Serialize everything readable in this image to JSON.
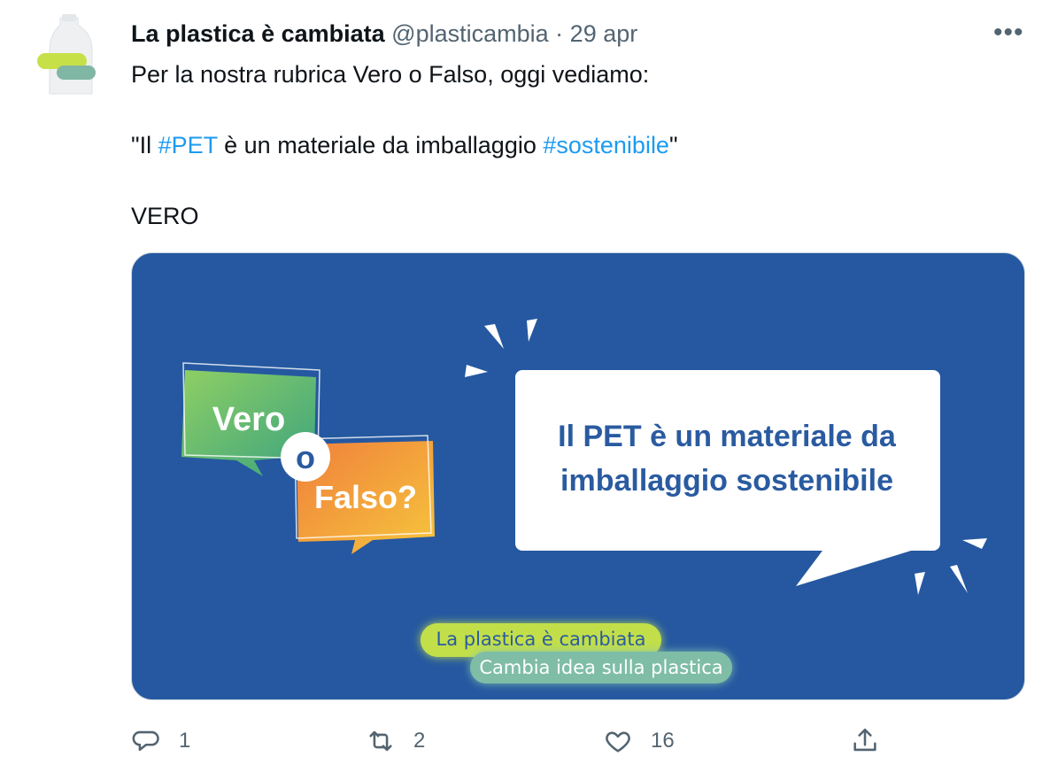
{
  "tweet": {
    "author_name": "La plastica è cambiata",
    "handle": "@plasticambia",
    "separator": "·",
    "date": "29 apr",
    "more_label": "•••",
    "text": {
      "line1": "Per la nostra rubrica Vero o Falso, oggi vediamo:",
      "quote_open": "\"Il ",
      "hashtag1": "#PET",
      "middle": " è un materiale da imballaggio ",
      "hashtag2": "#sostenibile",
      "quote_close": "\"",
      "verdict": "VERO"
    }
  },
  "media": {
    "bubble_vero": "Vero",
    "bubble_o": "o",
    "bubble_falso": "Falso?",
    "statement_line1": "Il PET è un materiale da",
    "statement_line2": "imballaggio sostenibile",
    "pill1": "La plastica è cambiata",
    "pill2": "Cambia idea sulla plastica",
    "colors": {
      "background": "#2558a0",
      "statement_text": "#2a5ba0",
      "green": "#7cc26b",
      "orange": "#f5a03a"
    }
  },
  "actions": {
    "reply_count": "1",
    "retweet_count": "2",
    "like_count": "16"
  },
  "icons": [
    "reply-icon",
    "retweet-icon",
    "like-icon",
    "share-icon",
    "more-icon"
  ]
}
